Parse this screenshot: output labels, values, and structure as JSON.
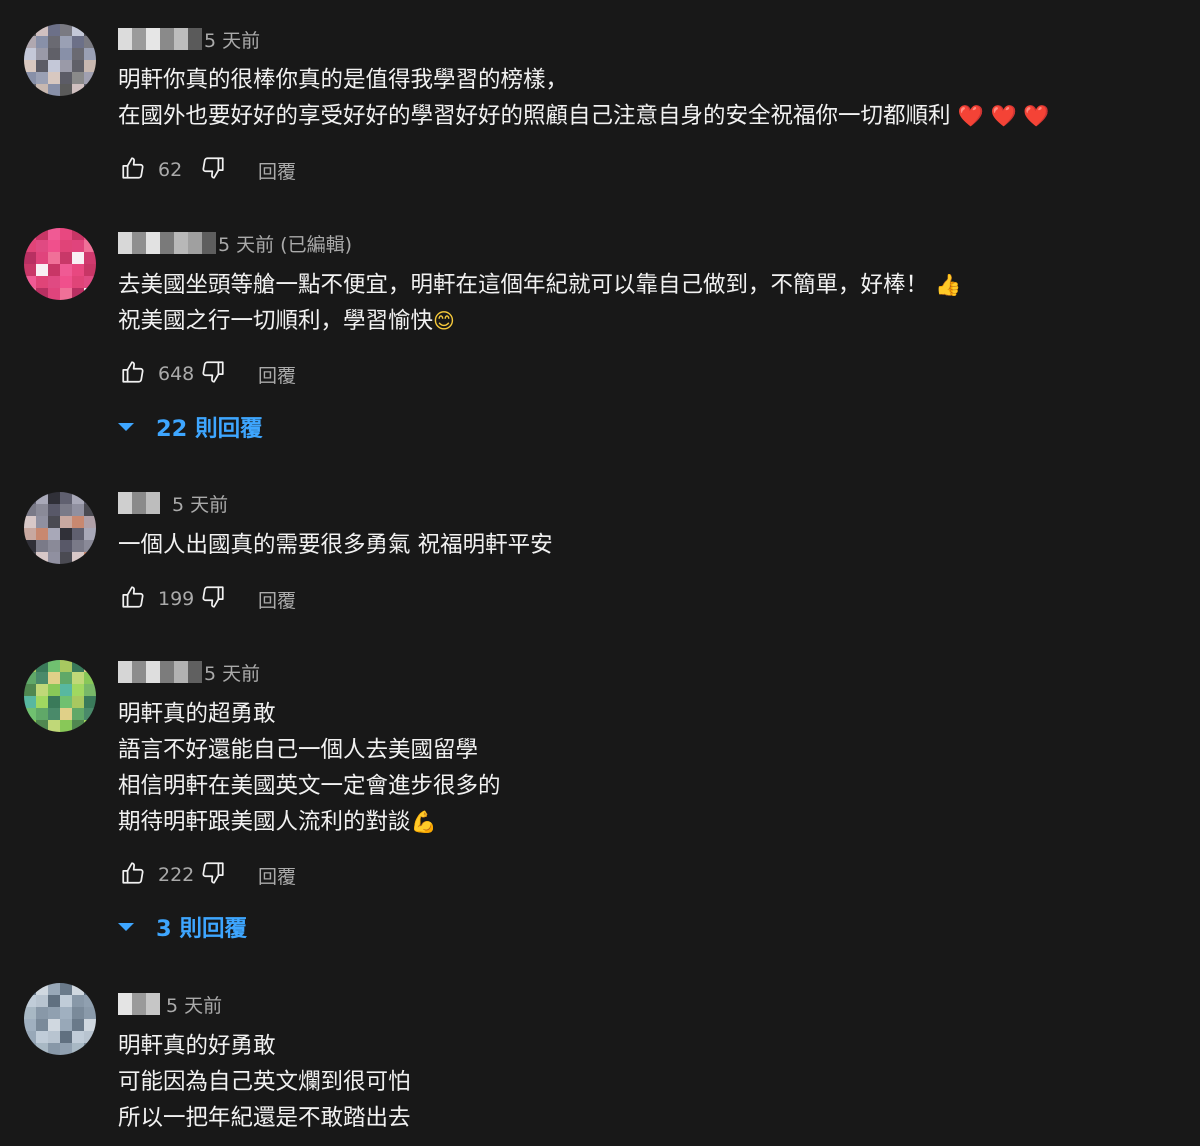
{
  "comments": [
    {
      "timestamp": "5 天前",
      "lines": [
        {
          "text": "明軒你真的很棒你真的是值得我學習的榜樣，",
          "emoji": ""
        },
        {
          "text": "在國外也要好好的享受好好的學習好好的照顧自己注意自身的安全祝福你一切都順利",
          "emoji": "❤️ ❤️ ❤️"
        }
      ],
      "likes": "62",
      "reply_label": "回覆",
      "replies_label": ""
    },
    {
      "timestamp": "5 天前 (已編輯)",
      "lines": [
        {
          "text": "去美國坐頭等艙一點不便宜，明軒在這個年紀就可以靠自己做到，不簡單，好棒！",
          "emoji": "👍"
        },
        {
          "text": "祝美國之行一切順利，學習愉快",
          "emoji": "😊"
        }
      ],
      "likes": "648",
      "reply_label": "回覆",
      "replies_label": "22 則回覆"
    },
    {
      "timestamp": "5 天前",
      "lines": [
        {
          "text": "一個人出國真的需要很多勇氣 祝福明軒平安",
          "emoji": ""
        }
      ],
      "likes": "199",
      "reply_label": "回覆",
      "replies_label": ""
    },
    {
      "timestamp": "5 天前",
      "lines": [
        {
          "text": "明軒真的超勇敢",
          "emoji": ""
        },
        {
          "text": "語言不好還能自己一個人去美國留學",
          "emoji": ""
        },
        {
          "text": "相信明軒在美國英文一定會進步很多的",
          "emoji": ""
        },
        {
          "text": "期待明軒跟美國人流利的對談",
          "emoji": "💪"
        }
      ],
      "likes": "222",
      "reply_label": "回覆",
      "replies_label": "3 則回覆"
    },
    {
      "timestamp": "5 天前",
      "lines": [
        {
          "text": "明軒真的好勇敢",
          "emoji": ""
        },
        {
          "text": "可能因為自己英文爛到很可怕",
          "emoji": ""
        },
        {
          "text": "所以一把年紀還是不敢踏出去",
          "emoji": ""
        }
      ],
      "likes": "",
      "reply_label": "",
      "replies_label": ""
    }
  ],
  "icons": {
    "like": "thumbs-up-icon",
    "dislike": "thumbs-down-icon",
    "expand": "caret-down-icon"
  },
  "colors": {
    "background": "#181818",
    "text": "#f1f1f1",
    "secondary": "#aaaaaa",
    "link": "#3ea6ff"
  }
}
